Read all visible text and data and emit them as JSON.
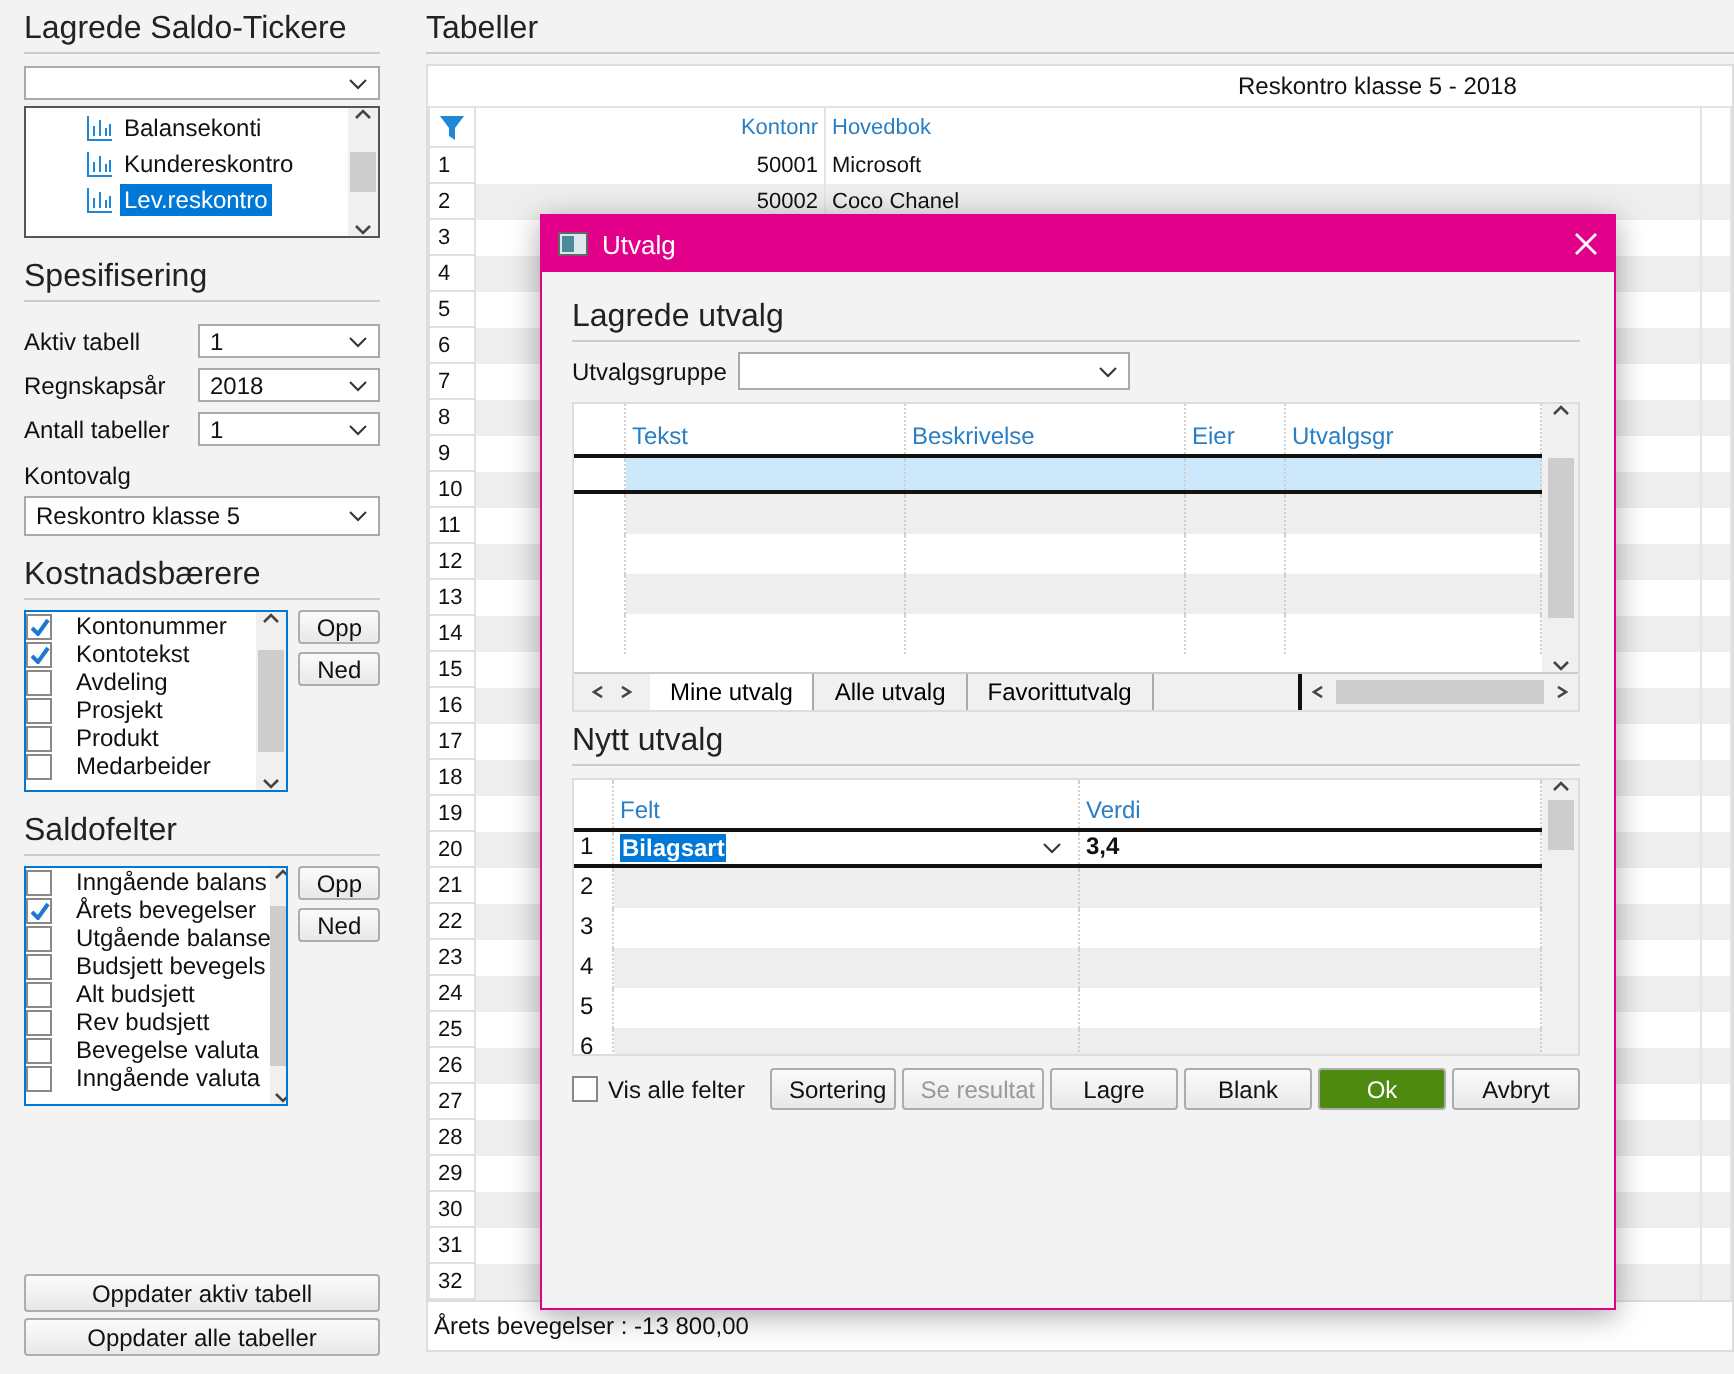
{
  "saved_tickers": {
    "title": "Lagrede Saldo-Tickere",
    "tree_items": [
      {
        "label": "Balansekonti",
        "selected": false
      },
      {
        "label": "Kundereskontro",
        "selected": false
      },
      {
        "label": "Lev.reskontro",
        "selected": true
      }
    ]
  },
  "specification": {
    "title": "Spesifisering",
    "fields": [
      {
        "label": "Aktiv tabell",
        "value": "1"
      },
      {
        "label": "Regnskapsår",
        "value": "2018"
      },
      {
        "label": "Antall tabeller",
        "value": "1"
      }
    ],
    "account_choice": {
      "label": "Kontovalg",
      "value": "Reskontro klasse 5"
    }
  },
  "cost_carriers": {
    "title": "Kostnadsbærere",
    "items": [
      {
        "label": "Kontonummer",
        "checked": true
      },
      {
        "label": "Kontotekst",
        "checked": true
      },
      {
        "label": "Avdeling",
        "checked": false
      },
      {
        "label": "Prosjekt",
        "checked": false
      },
      {
        "label": "Produkt",
        "checked": false
      },
      {
        "label": "Medarbeider",
        "checked": false
      }
    ],
    "buttons": [
      "Opp",
      "Ned"
    ]
  },
  "balance_fields": {
    "title": "Saldofelter",
    "items": [
      {
        "label": "Inngående balans",
        "checked": false
      },
      {
        "label": "Årets bevegelser",
        "checked": true
      },
      {
        "label": "Utgående balanse",
        "checked": false
      },
      {
        "label": "Budsjett bevegels",
        "checked": false
      },
      {
        "label": "Alt budsjett",
        "checked": false
      },
      {
        "label": "Rev budsjett",
        "checked": false
      },
      {
        "label": "Bevegelse valuta",
        "checked": false
      },
      {
        "label": "Inngående valuta",
        "checked": false
      }
    ],
    "buttons": [
      "Opp",
      "Ned"
    ]
  },
  "update_buttons": [
    "Oppdater aktiv tabell",
    "Oppdater alle tabeller"
  ],
  "tables": {
    "title": "Tabeller",
    "caption": "Reskontro klasse 5 - 2018",
    "columns": [
      "Kontonr",
      "Hovedbok"
    ],
    "rows": [
      {
        "num": "1",
        "kontonr": "50001",
        "hovedbok": "Microsoft"
      },
      {
        "num": "2",
        "kontonr": "50002",
        "hovedbok": "Coco Chanel"
      },
      {
        "num": "3"
      },
      {
        "num": "4"
      },
      {
        "num": "5"
      },
      {
        "num": "6"
      },
      {
        "num": "7"
      },
      {
        "num": "8"
      },
      {
        "num": "9"
      },
      {
        "num": "10"
      },
      {
        "num": "11"
      },
      {
        "num": "12"
      },
      {
        "num": "13"
      },
      {
        "num": "14"
      },
      {
        "num": "15"
      },
      {
        "num": "16"
      },
      {
        "num": "17"
      },
      {
        "num": "18"
      },
      {
        "num": "19"
      },
      {
        "num": "20"
      },
      {
        "num": "21"
      },
      {
        "num": "22"
      },
      {
        "num": "23"
      },
      {
        "num": "24"
      },
      {
        "num": "25"
      },
      {
        "num": "26"
      },
      {
        "num": "27"
      },
      {
        "num": "28"
      },
      {
        "num": "29"
      },
      {
        "num": "30"
      },
      {
        "num": "31"
      },
      {
        "num": "32"
      }
    ],
    "footer": "Årets bevegelser : -13 800,00"
  },
  "dialog": {
    "title": "Utvalg",
    "saved": {
      "title": "Lagrede utvalg",
      "group_label": "Utvalgsgruppe",
      "columns": [
        "Tekst",
        "Beskrivelse",
        "Eier",
        "Utvalgsgr"
      ],
      "rows": [
        {
          "selected": true
        },
        {
          "selected": false
        },
        {
          "selected": false
        },
        {
          "selected": false
        },
        {
          "selected": false
        }
      ],
      "tabs": [
        {
          "label": "Mine utvalg",
          "selected": true
        },
        {
          "label": "Alle utvalg",
          "selected": false
        },
        {
          "label": "Favorittutvalg",
          "selected": false
        }
      ]
    },
    "new": {
      "title": "Nytt utvalg",
      "columns": [
        "Felt",
        "Verdi"
      ],
      "rows": [
        {
          "num": "1",
          "felt": "Bilagsart",
          "verdi": "3,4",
          "selected": true
        },
        {
          "num": "2",
          "selected": false
        },
        {
          "num": "3",
          "selected": false
        },
        {
          "num": "4",
          "selected": false
        },
        {
          "num": "5",
          "selected": false
        },
        {
          "num": "6",
          "selected": false
        }
      ]
    },
    "show_all": {
      "label": "Vis alle felter",
      "checked": false
    },
    "buttons": [
      {
        "label": "Sortering",
        "kind": "normal"
      },
      {
        "label": "Se resultat",
        "kind": "disabled"
      },
      {
        "label": "Lagre",
        "kind": "normal"
      },
      {
        "label": "Blank",
        "kind": "normal"
      },
      {
        "label": "Ok",
        "kind": "primary"
      },
      {
        "label": "Avbryt",
        "kind": "normal"
      }
    ]
  }
}
